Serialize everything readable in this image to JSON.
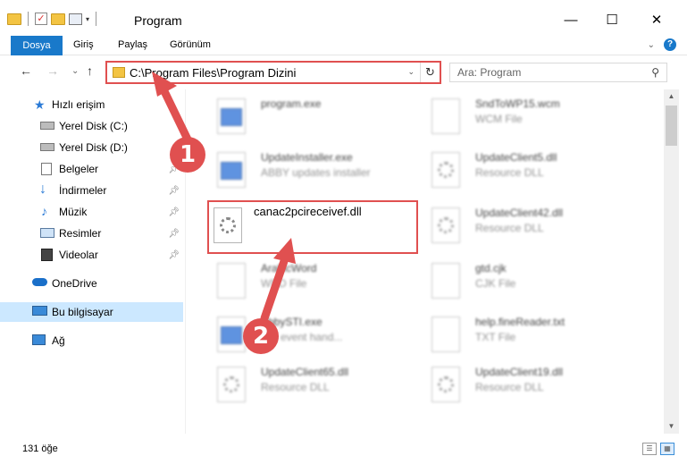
{
  "window": {
    "title": "Program",
    "minimize_glyph": "—",
    "maximize_glyph": "☐",
    "close_glyph": "✕"
  },
  "ribbon": {
    "file_tab": "Dosya",
    "tabs": [
      "Giriş",
      "Paylaş",
      "Görünüm"
    ]
  },
  "nav": {
    "back_glyph": "←",
    "forward_glyph": "→",
    "recent_glyph": "⌄",
    "up_glyph": "↑",
    "address": "C:\\Program Files\\Program Dizini",
    "dropdown_glyph": "⌄",
    "refresh_glyph": "↻",
    "search_placeholder": "Ara: Program",
    "search_glyph": "⚲"
  },
  "sidebar": {
    "items": [
      {
        "label": "Hızlı erişim",
        "icon": "star-icon"
      },
      {
        "label": "Yerel Disk (C:)",
        "icon": "drive-icon"
      },
      {
        "label": "Yerel Disk (D:)",
        "icon": "drive-icon"
      },
      {
        "label": "Belgeler",
        "icon": "documents-icon"
      },
      {
        "label": "İndirmeler",
        "icon": "download-icon"
      },
      {
        "label": "Müzik",
        "icon": "music-icon"
      },
      {
        "label": "Resimler",
        "icon": "pictures-icon"
      },
      {
        "label": "Videolar",
        "icon": "videos-icon"
      },
      {
        "label": "OneDrive",
        "icon": "cloud-icon"
      },
      {
        "label": "Bu bilgisayar",
        "icon": "computer-icon"
      },
      {
        "label": "Ağ",
        "icon": "network-icon"
      }
    ]
  },
  "files": [
    {
      "name": "program.exe",
      "type": "",
      "icon": "exe-icon"
    },
    {
      "name": "SndToWP15.wcm",
      "type": "WCM File",
      "icon": "file-icon"
    },
    {
      "name": "UpdateInstaller.exe",
      "type": "ABBY updates installer",
      "icon": "exe-icon"
    },
    {
      "name": "UpdateClient5.dll",
      "type": "Resource DLL",
      "icon": "dll-icon"
    },
    {
      "name": "canac2pcireceivef.dll",
      "type": "",
      "icon": "dll-icon"
    },
    {
      "name": "UpdateClient42.dll",
      "type": "Resource DLL",
      "icon": "dll-icon"
    },
    {
      "name": "ArabicWord",
      "type": "WRD File",
      "icon": "file-icon"
    },
    {
      "name": "gtd.cjk",
      "type": "CJK File",
      "icon": "file-icon"
    },
    {
      "name": "AbbySTI.exe",
      "type": "STI event hand...",
      "icon": "exe-icon"
    },
    {
      "name": "help.fineReader.txt",
      "type": "TXT File",
      "icon": "file-icon"
    },
    {
      "name": "UpdateClient65.dll",
      "type": "Resource DLL",
      "icon": "dll-icon"
    },
    {
      "name": "UpdateClient19.dll",
      "type": "Resource DLL",
      "icon": "dll-icon"
    }
  ],
  "status": {
    "count": "131 öğe"
  },
  "annotations": {
    "step1": "1",
    "step2": "2",
    "color": "#e05050"
  }
}
